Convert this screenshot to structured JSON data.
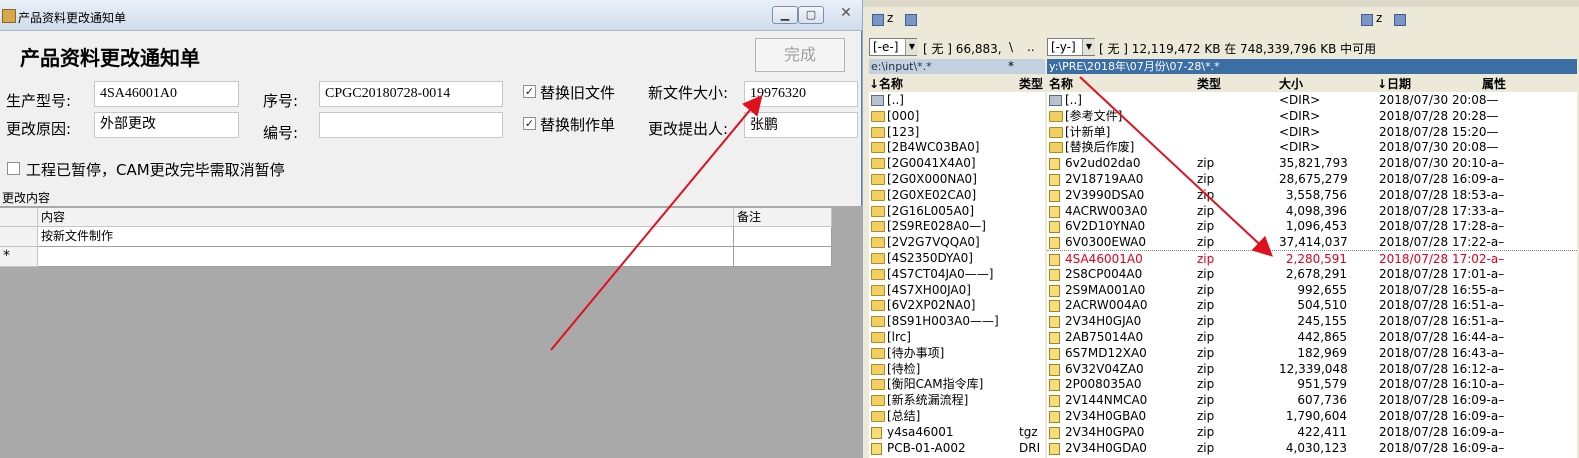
{
  "dialog": {
    "window_title": "产品资料更改通知单",
    "form_title": "产品资料更改通知单",
    "done_button": "完成",
    "fields": {
      "model_label": "生产型号:",
      "model_value": "4SA46001A0",
      "serial_label": "序号:",
      "serial_value": "CPGC20180728-0014",
      "replace_old_label": "替换旧文件",
      "new_size_label": "新文件大小:",
      "new_size_value": "19976320",
      "reason_label": "更改原因:",
      "reason_value": "外部更改",
      "number_label": "编号:",
      "number_value": "",
      "replace_sheet_label": "替换制作单",
      "proposer_label": "更改提出人:",
      "proposer_value": "张鹏",
      "paused_label": "工程已暂停，CAM更改完毕需取消暂停"
    },
    "section_label": "更改内容",
    "grid": {
      "col_content": "内容",
      "col_note": "备注",
      "row1_content": "按新文件制作",
      "row1_note": "",
      "new_row_marker": "*"
    },
    "checkboxes": {
      "replace_old": true,
      "replace_sheet": true,
      "paused": false
    }
  },
  "file_manager": {
    "left_drive": "[-e-]",
    "left_drive_label": "[ 无 ]  66,883,",
    "left_path_btns": [
      "\\",
      ".."
    ],
    "left_path": "e:\\input\\*.*",
    "left_filter": "*",
    "right_drive": "[-y-]",
    "right_drive_info": "[ 无 ]  12,119,472 KB 在 748,339,796 KB 中可用",
    "right_path": "y:\\PRE\\2018年\\07月份\\07-28\\*.*",
    "toolbar_left_z": "z",
    "toolbar_right_z": "z",
    "left_headers": {
      "name": "↓名称",
      "type": "类型"
    },
    "right_headers": {
      "name": "名称",
      "type": "类型",
      "size": "大小",
      "date": "↓日期",
      "attr": "属性"
    },
    "left_items": [
      {
        "name": "[..]",
        "kind": "up",
        "type": ""
      },
      {
        "name": "[000]",
        "kind": "folder",
        "type": ""
      },
      {
        "name": "[123]",
        "kind": "folder",
        "type": ""
      },
      {
        "name": "[2B4WC03BA0]",
        "kind": "folder",
        "type": ""
      },
      {
        "name": "[2G0041X4A0]",
        "kind": "folder",
        "type": ""
      },
      {
        "name": "[2G0X000NA0]",
        "kind": "folder",
        "type": ""
      },
      {
        "name": "[2G0XE02CA0]",
        "kind": "folder",
        "type": ""
      },
      {
        "name": "[2G16L005A0]",
        "kind": "folder",
        "type": ""
      },
      {
        "name": "[2S9RE028A0—]",
        "kind": "folder",
        "type": ""
      },
      {
        "name": "[2V2G7VQQA0]",
        "kind": "folder",
        "type": ""
      },
      {
        "name": "[4S2350DYA0]",
        "kind": "folder",
        "type": ""
      },
      {
        "name": "[4S7CT04JA0——]",
        "kind": "folder",
        "type": ""
      },
      {
        "name": "[4S7XH00JA0]",
        "kind": "folder",
        "type": ""
      },
      {
        "name": "[6V2XP02NA0]",
        "kind": "folder",
        "type": ""
      },
      {
        "name": "[8S91H003A0——]",
        "kind": "folder",
        "type": ""
      },
      {
        "name": "[lrc]",
        "kind": "folder",
        "type": ""
      },
      {
        "name": "[待办事项]",
        "kind": "folder",
        "type": ""
      },
      {
        "name": "[待检]",
        "kind": "folder",
        "type": ""
      },
      {
        "name": "[衡阳CAM指令库]",
        "kind": "folder",
        "type": ""
      },
      {
        "name": "[新系统漏流程]",
        "kind": "folder",
        "type": ""
      },
      {
        "name": "[总结]",
        "kind": "folder",
        "type": ""
      },
      {
        "name": "y4sa46001",
        "kind": "zip",
        "type": "tgz"
      },
      {
        "name": "PCB-01-A002",
        "kind": "zip",
        "type": "DRI"
      }
    ],
    "right_items": [
      {
        "name": "[..]",
        "kind": "up",
        "type": "",
        "size": "<DIR>",
        "date": "2018/07/30 20:08—",
        "selected": false
      },
      {
        "name": "[参考文件]",
        "kind": "folder",
        "type": "",
        "size": "<DIR>",
        "date": "2018/07/28 20:28—",
        "selected": false
      },
      {
        "name": "[计新单]",
        "kind": "folder",
        "type": "",
        "size": "<DIR>",
        "date": "2018/07/28 15:20—",
        "selected": false
      },
      {
        "name": "[替换后作废]",
        "kind": "folder",
        "type": "",
        "size": "<DIR>",
        "date": "2018/07/30 20:08—",
        "selected": false
      },
      {
        "name": "6v2ud02da0",
        "kind": "zip",
        "type": "zip",
        "size": "35,821,793",
        "date": "2018/07/30 20:10-a–",
        "selected": false
      },
      {
        "name": "2V18719AA0",
        "kind": "zip",
        "type": "zip",
        "size": "28,675,279",
        "date": "2018/07/28 16:09-a–",
        "selected": false
      },
      {
        "name": "2V3990DSA0",
        "kind": "zip",
        "type": "zip",
        "size": "3,558,756",
        "date": "2018/07/28 18:53-a–",
        "selected": false
      },
      {
        "name": "4ACRW003A0",
        "kind": "zip",
        "type": "zip",
        "size": "4,098,396",
        "date": "2018/07/28 17:33-a–",
        "selected": false
      },
      {
        "name": "6V2D10YNA0",
        "kind": "zip",
        "type": "zip",
        "size": "1,096,453",
        "date": "2018/07/28 17:28-a–",
        "selected": false
      },
      {
        "name": "6V0300EWA0",
        "kind": "zip",
        "type": "zip",
        "size": "37,414,037",
        "date": "2018/07/28 17:22-a–",
        "selected": false
      },
      {
        "name": "4SA46001A0",
        "kind": "zip",
        "type": "zip",
        "size": "2,280,591",
        "date": "2018/07/28 17:02-a–",
        "selected": true
      },
      {
        "name": "2S8CP004A0",
        "kind": "zip",
        "type": "zip",
        "size": "2,678,291",
        "date": "2018/07/28 17:01-a–",
        "selected": false
      },
      {
        "name": "2S9MA001A0",
        "kind": "zip",
        "type": "zip",
        "size": "992,655",
        "date": "2018/07/28 16:55-a–",
        "selected": false
      },
      {
        "name": "2ACRW004A0",
        "kind": "zip",
        "type": "zip",
        "size": "504,510",
        "date": "2018/07/28 16:51-a–",
        "selected": false
      },
      {
        "name": "2V34H0GJA0",
        "kind": "zip",
        "type": "zip",
        "size": "245,155",
        "date": "2018/07/28 16:51-a–",
        "selected": false
      },
      {
        "name": "2AB75014A0",
        "kind": "zip",
        "type": "zip",
        "size": "442,865",
        "date": "2018/07/28 16:44-a–",
        "selected": false
      },
      {
        "name": "6S7MD12XA0",
        "kind": "zip",
        "type": "zip",
        "size": "182,969",
        "date": "2018/07/28 16:43-a–",
        "selected": false
      },
      {
        "name": "6V32V04ZA0",
        "kind": "zip",
        "type": "zip",
        "size": "12,339,048",
        "date": "2018/07/28 16:12-a–",
        "selected": false
      },
      {
        "name": "2P008035A0",
        "kind": "zip",
        "type": "zip",
        "size": "951,579",
        "date": "2018/07/28 16:10-a–",
        "selected": false
      },
      {
        "name": "2V144NMCA0",
        "kind": "zip",
        "type": "zip",
        "size": "607,736",
        "date": "2018/07/28 16:09-a–",
        "selected": false
      },
      {
        "name": "2V34H0GBA0",
        "kind": "zip",
        "type": "zip",
        "size": "1,790,604",
        "date": "2018/07/28 16:09-a–",
        "selected": false
      },
      {
        "name": "2V34H0GPA0",
        "kind": "zip",
        "type": "zip",
        "size": "422,411",
        "date": "2018/07/28 16:09-a–",
        "selected": false
      },
      {
        "name": "2V34H0GDA0",
        "kind": "zip",
        "type": "zip",
        "size": "4,030,123",
        "date": "2018/07/28 16:09-a–",
        "selected": false
      }
    ]
  },
  "colors": {
    "annotation_arrow": "#e0101f",
    "selected_file": "#e1001f"
  }
}
